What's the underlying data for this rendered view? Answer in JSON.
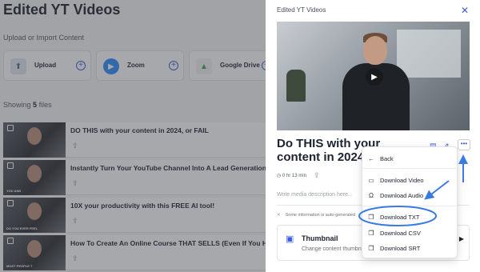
{
  "background": {
    "title": "Edited YT Videos",
    "upload_section_label": "Upload or Import Content",
    "import_cards": [
      {
        "label": "Upload",
        "icon": "upload-icon",
        "color": "#dfe6f2"
      },
      {
        "label": "Zoom",
        "icon": "zoom-icon",
        "color": "#2d8cff"
      },
      {
        "label": "Google Drive",
        "icon": "google-drive-icon",
        "color": "#f2f2f2"
      }
    ],
    "showing_prefix": "Showing",
    "showing_count": "5",
    "showing_suffix": "files",
    "files": [
      {
        "title": "DO THIS with your content in 2024, or FAIL",
        "thumb_caption": ""
      },
      {
        "title": "Instantly Turn Your YouTube Channel Into A Lead Generation Mac",
        "thumb_caption": "YOU AND"
      },
      {
        "title": "10X your productivity with this FREE AI tool!",
        "thumb_caption": "DO YOU EVER FEEL"
      },
      {
        "title": "How To Create An Online Course THAT SELLS (Even If You Have N",
        "thumb_caption": "MOST PEOPLE T"
      }
    ]
  },
  "drawer": {
    "title": "Edited YT Videos",
    "close_icon": "close-icon",
    "video_title": "Do THIS with your content in 2024, or FAIL",
    "duration": "0 hr 13 min",
    "description_placeholder": "Write media description here...",
    "info_text": "Some information is auto-generated",
    "thumbnail_card": {
      "heading": "Thumbnail",
      "subtext": "Change content thumbn"
    }
  },
  "menu": {
    "items": [
      {
        "label": "Back",
        "icon": "arrow-left-icon"
      },
      {
        "label": "Download Video",
        "icon": "video-icon"
      },
      {
        "label": "Download Audio",
        "icon": "headphones-icon"
      },
      {
        "label": "Download TXT",
        "icon": "file-icon",
        "highlighted": true
      },
      {
        "label": "Download CSV",
        "icon": "file-icon"
      },
      {
        "label": "Download SRT",
        "icon": "file-icon"
      }
    ]
  },
  "colors": {
    "accent": "#3a5bd9",
    "annotation": "#3a7be0",
    "overlay": "#3c3e44"
  }
}
